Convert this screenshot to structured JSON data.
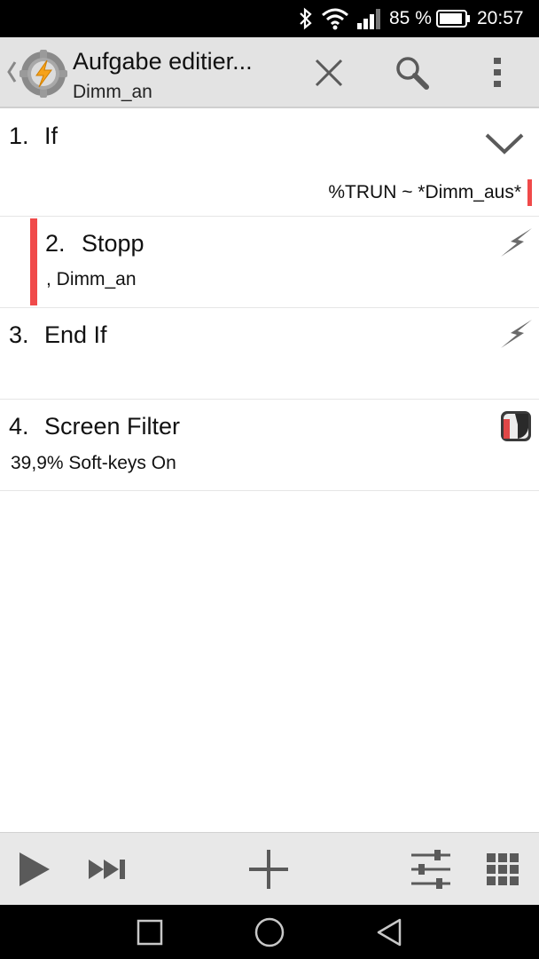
{
  "status_bar": {
    "battery_percent": "85 %",
    "time": "20:57",
    "icons": [
      "bluetooth-icon",
      "wifi-icon",
      "signal-icon",
      "battery-icon"
    ]
  },
  "action_bar": {
    "title": "Aufgabe editier...",
    "subtitle": "Dimm_an",
    "buttons": [
      "close-icon",
      "search-icon",
      "overflow-menu-icon"
    ]
  },
  "actions": [
    {
      "number": "1.",
      "name": "If",
      "args": "%TRUN ~ *Dimm_aus*",
      "icon": "chevron-down-icon"
    },
    {
      "number": "2.",
      "name": "Stopp",
      "args": ",  Dimm_an",
      "icon": "lightning-icon"
    },
    {
      "number": "3.",
      "name": "End If",
      "args": "",
      "icon": "lightning-icon"
    },
    {
      "number": "4.",
      "name": "Screen Filter",
      "args": "39,9% Soft-keys On",
      "icon": "screen-filter-icon"
    }
  ],
  "toolbar": {
    "buttons": [
      "play-icon",
      "step-forward-icon",
      "add-icon",
      "settings-sliders-icon",
      "grid-icon"
    ]
  },
  "nav_bar": {
    "buttons": [
      "recents-icon",
      "home-icon",
      "back-icon"
    ]
  },
  "colors": {
    "accent_red": "#f04a4a",
    "action_bar_bg": "#e3e3e3",
    "toolbar_bg": "#e8e8e8"
  }
}
